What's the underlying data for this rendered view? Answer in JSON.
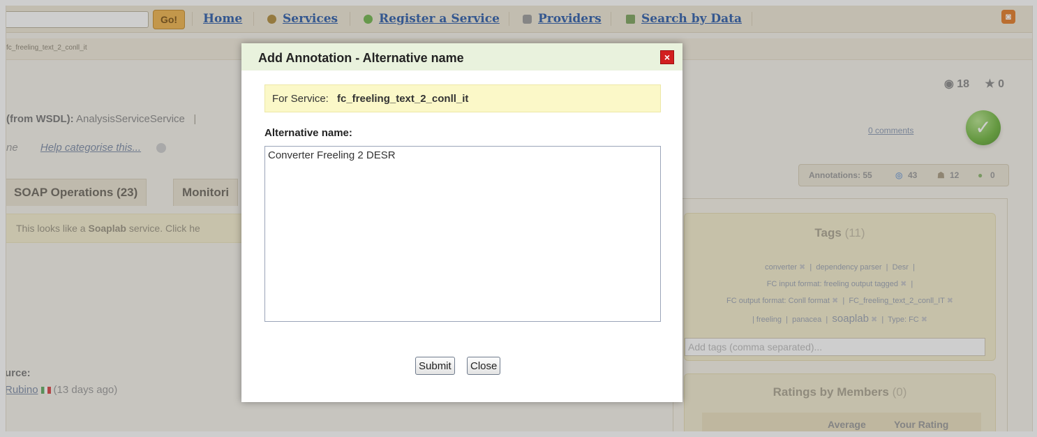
{
  "nav": {
    "go_label": "Go!",
    "items": [
      {
        "label": "Home"
      },
      {
        "label": "Services",
        "icon": "gear-icon"
      },
      {
        "label": "Register a Service",
        "icon": "plus-circle-icon"
      },
      {
        "label": "Providers",
        "icon": "providers-icon"
      },
      {
        "label": "Search by Data",
        "icon": "database-icon"
      }
    ],
    "rss_icon": "rss-icon"
  },
  "breadcrumb": "fc_freeling_text_2_conll_it",
  "service": {
    "wsdl_prefix": "(from WSDL):",
    "wsdl_name": "AnalysisServiceService",
    "category_prefix": "ne",
    "category_link": "Help categorise this...",
    "views": "18",
    "favourites": "0",
    "comments": "0 comments"
  },
  "annotations": {
    "total_label": "Annotations: 55",
    "count_a": "43",
    "count_b": "12",
    "count_c": "0"
  },
  "tabs": [
    {
      "label": "SOAP Operations (23)"
    },
    {
      "label": "Monitori"
    }
  ],
  "soaplab_note": {
    "before": "This looks like a ",
    "bold": "Soaplab",
    "after": " service. Click he"
  },
  "source": {
    "label": "urce:",
    "name": "Rubino",
    "when": "(13 days ago)"
  },
  "tags": {
    "title": "Tags",
    "count": "(11)",
    "line1": [
      "converter",
      "dependency parser",
      "Desr"
    ],
    "line2": "FC input format: freeling output tagged",
    "line3": [
      "FC output format: Conll format",
      "FC_freeling_text_2_conll_IT"
    ],
    "line4": [
      "freeling",
      "panacea",
      "soaplab",
      "Type: FC"
    ],
    "input_placeholder": "Add tags (comma separated)..."
  },
  "ratings": {
    "title": "Ratings by Members",
    "count": "(0)",
    "col_average": "Average",
    "col_yours": "Your Rating"
  },
  "dialog": {
    "title": "Add Annotation - Alternative name",
    "close_symbol": "×",
    "for_service_label": "For Service:",
    "service_name": "fc_freeling_text_2_conll_it",
    "alt_label": "Alternative name:",
    "alt_value": "Converter Freeling 2 DESR",
    "submit_label": "Submit",
    "close_label": "Close"
  }
}
